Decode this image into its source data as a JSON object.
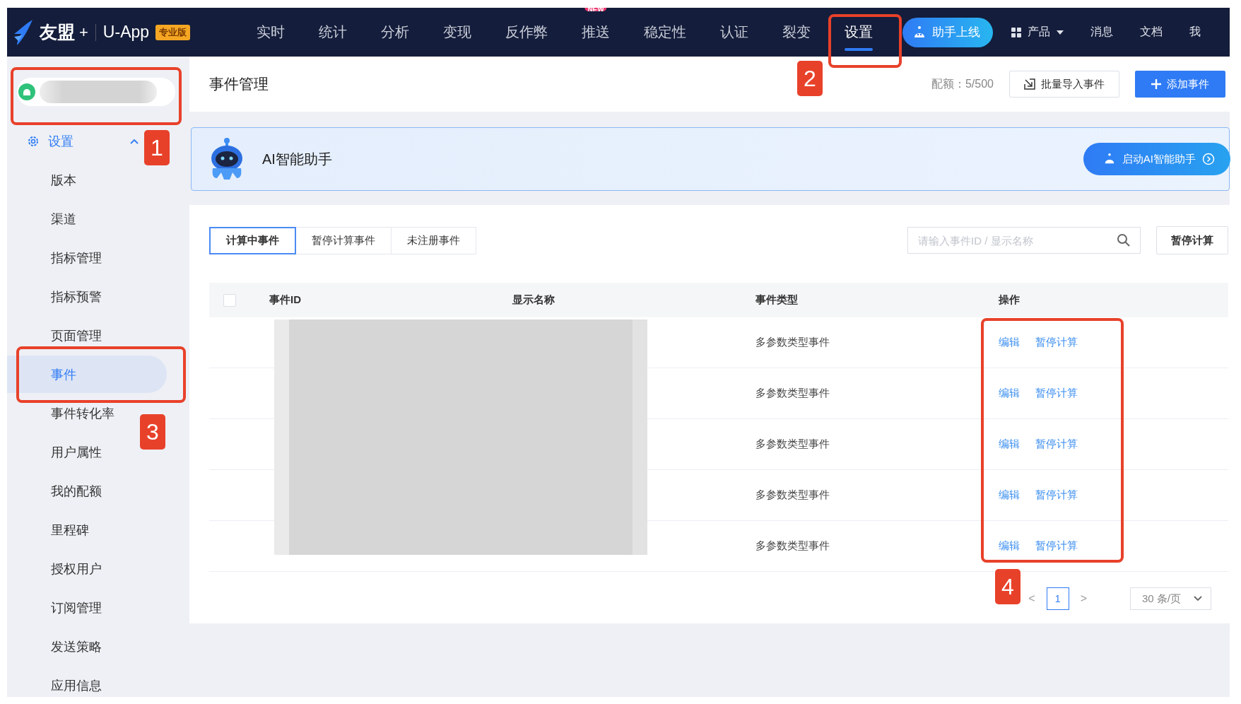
{
  "topbar": {
    "brand": "友盟",
    "plus": "+",
    "product": "U-App",
    "edition": "专业版",
    "nav": [
      {
        "label": "实时",
        "selected": false
      },
      {
        "label": "统计",
        "selected": false
      },
      {
        "label": "分析",
        "selected": false
      },
      {
        "label": "变现",
        "selected": false
      },
      {
        "label": "反作弊",
        "selected": false
      },
      {
        "label": "推送",
        "selected": false,
        "badge": "NEW"
      },
      {
        "label": "稳定性",
        "selected": false
      },
      {
        "label": "认证",
        "selected": false
      },
      {
        "label": "裂变",
        "selected": false
      },
      {
        "label": "设置",
        "selected": true
      }
    ],
    "assistant": "助手上线",
    "products": "产品",
    "messages": "消息",
    "docs": "文档",
    "account": "我"
  },
  "sidebar": {
    "section": {
      "label": "设置",
      "expanded": true,
      "children": [
        {
          "label": "版本",
          "selected": false
        },
        {
          "label": "渠道",
          "selected": false
        },
        {
          "label": "指标管理",
          "selected": false
        },
        {
          "label": "指标预警",
          "selected": false
        },
        {
          "label": "页面管理",
          "selected": false
        },
        {
          "label": "事件",
          "selected": true
        },
        {
          "label": "事件转化率",
          "selected": false
        },
        {
          "label": "用户属性",
          "selected": false
        },
        {
          "label": "我的配额",
          "selected": false
        },
        {
          "label": "里程碑",
          "selected": false
        },
        {
          "label": "授权用户",
          "selected": false
        },
        {
          "label": "订阅管理",
          "selected": false
        },
        {
          "label": "发送策略",
          "selected": false
        },
        {
          "label": "应用信息",
          "selected": false
        }
      ]
    }
  },
  "header": {
    "title": "事件管理",
    "quota": "配额：5/500",
    "import_button": "批量导入事件",
    "add_button": "添加事件"
  },
  "assistant_banner": {
    "title": "AI智能助手",
    "button": "启动AI智能助手"
  },
  "tabs": [
    {
      "label": "计算中事件",
      "selected": true
    },
    {
      "label": "暂停计算事件",
      "selected": false
    },
    {
      "label": "未注册事件",
      "selected": false
    }
  ],
  "search": {
    "placeholder": "请输入事件ID / 显示名称"
  },
  "pause_button": "暂停计算",
  "table": {
    "columns": [
      "事件ID",
      "显示名称",
      "事件类型",
      "操作"
    ],
    "select_all": {
      "checked": false
    },
    "rows": [
      {
        "type": "多参数类型事件",
        "actions": [
          "编辑",
          "暂停计算"
        ]
      },
      {
        "type": "多参数类型事件",
        "actions": [
          "编辑",
          "暂停计算"
        ]
      },
      {
        "type": "多参数类型事件",
        "actions": [
          "编辑",
          "暂停计算"
        ]
      },
      {
        "type": "多参数类型事件",
        "actions": [
          "编辑",
          "暂停计算"
        ]
      },
      {
        "type": "多参数类型事件",
        "actions": [
          "编辑",
          "暂停计算"
        ]
      }
    ]
  },
  "pagination": {
    "prev": "<",
    "pages": [
      {
        "label": "1",
        "selected": true
      }
    ],
    "next": ">",
    "page_size": "30 条/页"
  },
  "annotations": [
    {
      "number": "1"
    },
    {
      "number": "2"
    },
    {
      "number": "3"
    },
    {
      "number": "4"
    }
  ]
}
